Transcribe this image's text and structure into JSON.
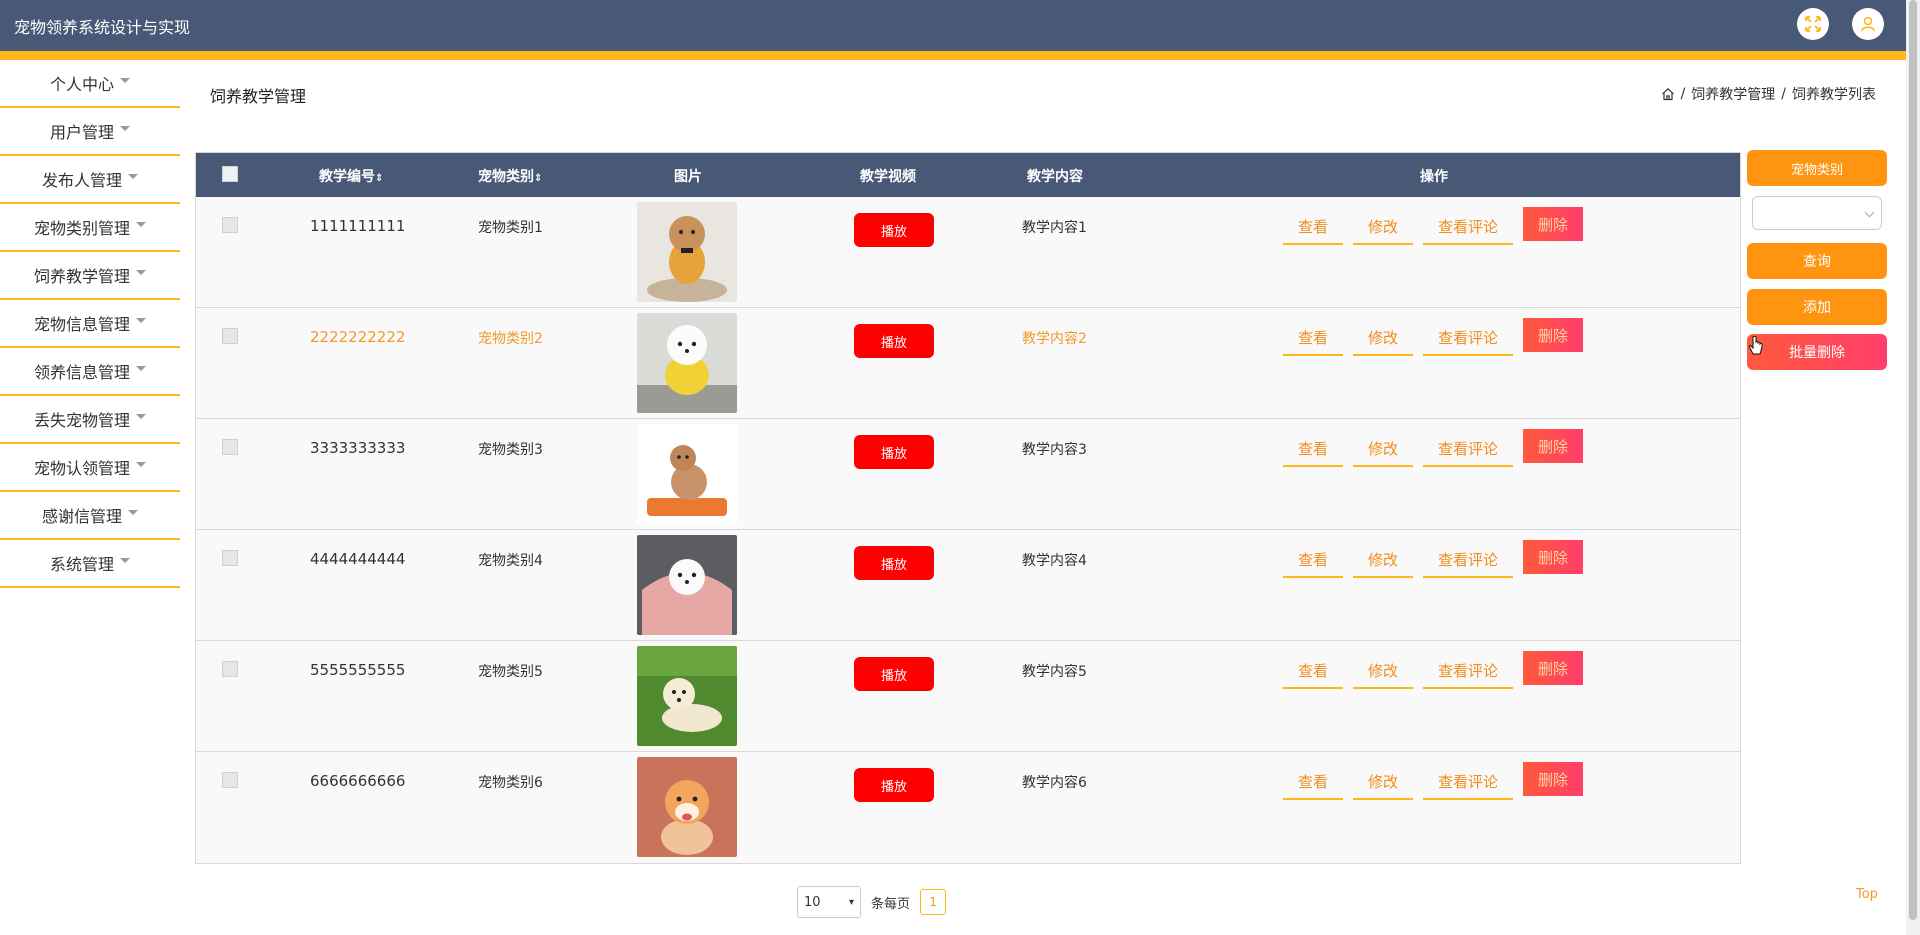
{
  "app": {
    "title": "宠物领养系统设计与实现"
  },
  "colors": {
    "header": "#485877",
    "accent": "#ffb71a",
    "orange_button": "#ff9410",
    "play": "#ff0000",
    "delete": "#ff3e6a"
  },
  "header": {
    "fullscreen_icon": "expand-icon",
    "user_icon": "user-icon"
  },
  "sidebar": {
    "items": [
      {
        "label": "个人中心"
      },
      {
        "label": "用户管理"
      },
      {
        "label": "发布人管理"
      },
      {
        "label": "宠物类别管理"
      },
      {
        "label": "饲养教学管理"
      },
      {
        "label": "宠物信息管理"
      },
      {
        "label": "领养信息管理"
      },
      {
        "label": "丢失宠物管理"
      },
      {
        "label": "宠物认领管理"
      },
      {
        "label": "感谢信管理"
      },
      {
        "label": "系统管理"
      }
    ]
  },
  "page": {
    "title": "饲养教学管理",
    "breadcrumb": {
      "home_icon": "home-icon",
      "sep": "/",
      "level1": "饲养教学管理",
      "level2": "饲养教学列表"
    }
  },
  "table": {
    "headers": {
      "code": "教学编号",
      "category": "宠物类别",
      "image": "图片",
      "video": "教学视频",
      "content": "教学内容",
      "actions": "操作"
    },
    "play_label": "播放",
    "action_labels": {
      "view": "查看",
      "edit": "修改",
      "comments": "查看评论",
      "delete": "删除"
    },
    "rows": [
      {
        "code": "1111111111",
        "category": "宠物类别1",
        "content": "教学内容1"
      },
      {
        "code": "2222222222",
        "category": "宠物类别2",
        "content": "教学内容2"
      },
      {
        "code": "3333333333",
        "category": "宠物类别3",
        "content": "教学内容3"
      },
      {
        "code": "4444444444",
        "category": "宠物类别4",
        "content": "教学内容4"
      },
      {
        "code": "5555555555",
        "category": "宠物类别5",
        "content": "教学内容5"
      },
      {
        "code": "6666666666",
        "category": "宠物类别6",
        "content": "教学内容6"
      }
    ]
  },
  "filters": {
    "category_label": "宠物类别",
    "category_value": "",
    "query_label": "查询",
    "add_label": "添加",
    "batch_delete_label": "批量删除"
  },
  "pagination": {
    "page_size": "10",
    "per_page_label": "条每页",
    "current_page": "1"
  },
  "top_link": "Top"
}
